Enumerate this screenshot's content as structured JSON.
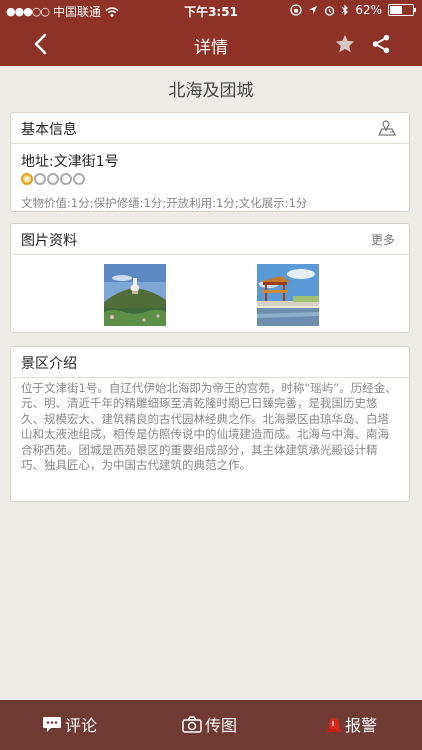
{
  "status_bar": {
    "carrier": "中国联通",
    "time": "下午3:51",
    "battery": "62%",
    "battery_level": 0.62
  },
  "nav": {
    "title": "详情",
    "back_icon": "chevron-left-icon",
    "favorite_icon": "star-icon",
    "share_icon": "share-icon"
  },
  "place": {
    "name": "北海及团城"
  },
  "basic_info": {
    "header": "基本信息",
    "map_icon": "map-icon",
    "address": "地址:文津街1号",
    "rating": 1,
    "rating_max": 5,
    "scores": "文物价值:1分;保护修缮:1分;开放利用:1分;文化展示:1分"
  },
  "photos": {
    "header": "图片资料",
    "more": "更多",
    "items": [
      {
        "name": "white-pagoda-photo"
      },
      {
        "name": "pavilion-photo"
      }
    ]
  },
  "intro": {
    "header": "景区介绍",
    "text": "位于文津街1号。自辽代伊始北海即为帝王的宫苑，时称“瑶屿”。历经金、元、明、清近千年的精雕细琢至清乾隆时期已日臻完善，是我国历史悠久、规模宏大、建筑精良的古代园林经典之作。北海景区由琼华岛、白塔山和太液池组成，相传是仿照传说中的仙境建造而成。北海与中海、南海合称西苑。团城是西苑景区的重要组成部分，其主体建筑承光殿设计精巧、独具匠心，为中国古代建筑的典范之作。"
  },
  "tabbar": {
    "comment": "评论",
    "upload": "传图",
    "report": "报警"
  },
  "colors": {
    "header_bg": "#8e3227",
    "tabbar_bg": "#6e3a32",
    "page_bg": "#efebe6",
    "rating_on": "#e0a21a"
  }
}
